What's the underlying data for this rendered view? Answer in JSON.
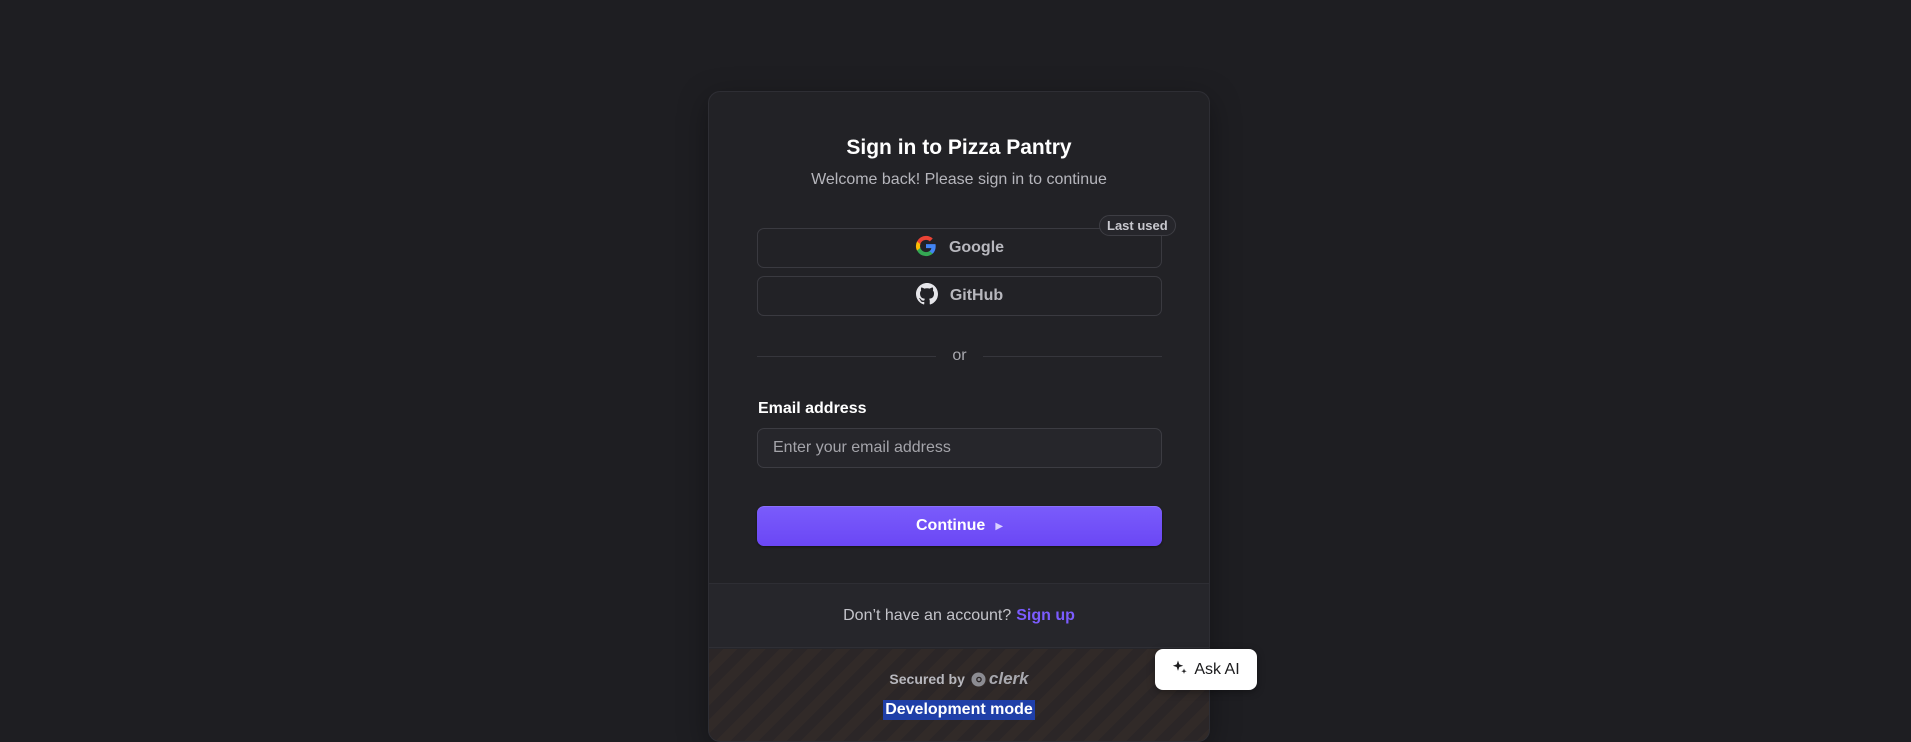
{
  "signin": {
    "title": "Sign in to Pizza Pantry",
    "subtitle": "Welcome back! Please sign in to continue",
    "providers": [
      {
        "label": "Google",
        "icon": "google-icon"
      },
      {
        "label": "GitHub",
        "icon": "github-icon"
      }
    ],
    "last_used_badge": "Last used",
    "divider": "or",
    "email": {
      "label": "Email address",
      "value": "",
      "placeholder": "Enter your email address"
    },
    "continue_label": "Continue",
    "continue_icon": "caret-right-icon"
  },
  "footer": {
    "prompt": "Don’t have an account?",
    "signup_link": "Sign up",
    "secured_by": "Secured by",
    "brand": "clerk",
    "dev_mode": "Development mode"
  },
  "ask_ai": {
    "label": "Ask AI",
    "icon": "sparkle-icon"
  },
  "colors": {
    "background": "#1e1e22",
    "card": "#222226",
    "accent": "#6c47ff",
    "link": "#7b5cff",
    "highlight": "#1f3fa8"
  }
}
